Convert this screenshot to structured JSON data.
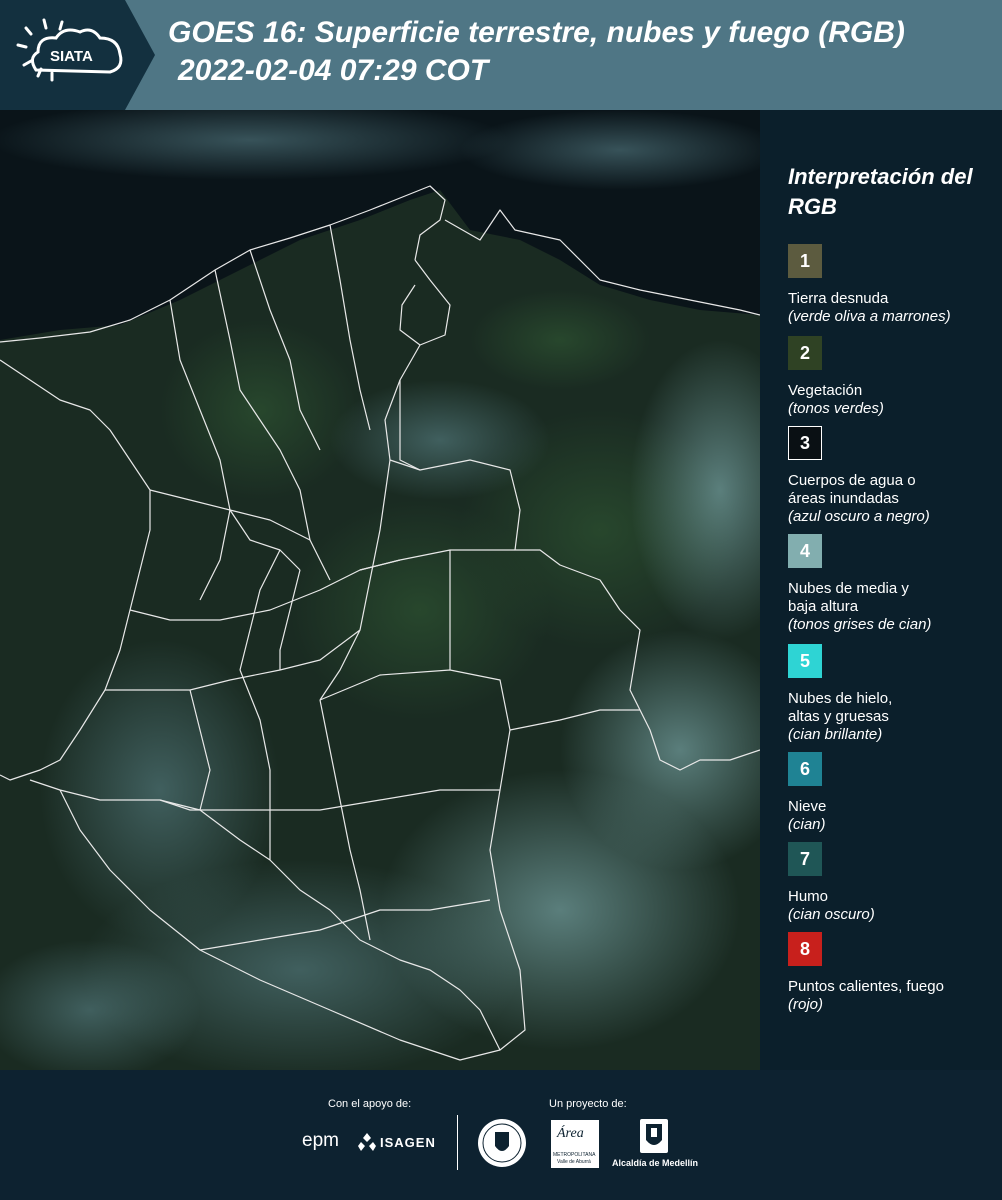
{
  "header": {
    "logo_text": "SIATA",
    "title_line1": "GOES 16: Superficie terrestre, nubes y fuego (RGB)",
    "title_line2": "2022-02-04 07:29 COT"
  },
  "legend": {
    "title": "Interpretación del RGB",
    "items": [
      {
        "num": "1",
        "color": "#5c5b3f",
        "label": "Tierra desnuda",
        "sub": "(verde oliva a marrones)"
      },
      {
        "num": "2",
        "color": "#2f4224",
        "label": "Vegetación",
        "sub": "(tonos verdes)"
      },
      {
        "num": "3",
        "color": "#0a1014",
        "label": "Cuerpos de agua o áreas inundadas",
        "sub": "(azul oscuro a negro)"
      },
      {
        "num": "4",
        "color": "#82aeaf",
        "label": "Nubes de media y baja altura",
        "sub": "(tonos grises de cian)"
      },
      {
        "num": "5",
        "color": "#2ed4d4",
        "label": "Nubes de hielo, altas y gruesas",
        "sub": "(cian brillante)"
      },
      {
        "num": "6",
        "color": "#1f8394",
        "label": "Nieve",
        "sub": "(cian)"
      },
      {
        "num": "7",
        "color": "#1f5656",
        "label": "Humo",
        "sub": "(cian oscuro)"
      },
      {
        "num": "8",
        "color": "#c8201c",
        "label": "Puntos calientes, fuego",
        "sub": "(rojo)"
      }
    ]
  },
  "footer": {
    "support_label": "Con el apoyo de:",
    "project_label": "Un proyecto de:",
    "epm_logo": "epm",
    "isagen_logo": "ISAGEN",
    "area_logo": "Área",
    "area_sub": "METROPOLITANA",
    "area_sub2": "Valle de Aburrá",
    "alcaldia_logo": "Alcaldía de Medellín"
  },
  "colors": {
    "header_bg": "#4f7685",
    "logo_bg": "#13303f",
    "page_bg": "#0d2230",
    "land": "#1b2a20",
    "ocean": "#0a1218",
    "cloud": "#7fb4b8"
  }
}
